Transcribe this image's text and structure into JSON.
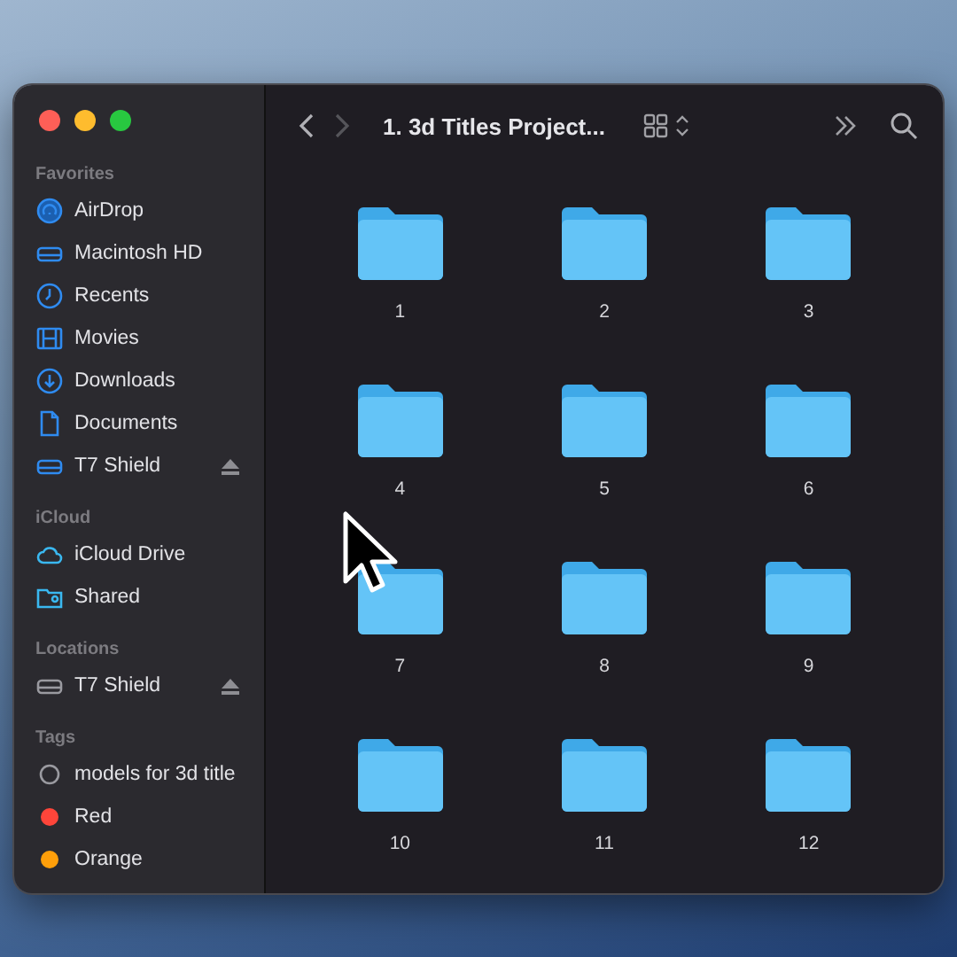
{
  "window": {
    "title": "1. 3d Titles Project..."
  },
  "toolbar": {
    "back_enabled": true,
    "forward_enabled": false
  },
  "sidebar": [
    {
      "heading": "Favorites",
      "items": [
        {
          "label": "AirDrop",
          "kind": "airdrop",
          "ejectable": false
        },
        {
          "label": "Macintosh HD",
          "kind": "drive",
          "ejectable": false
        },
        {
          "label": "Recents",
          "kind": "clock",
          "ejectable": false
        },
        {
          "label": "Movies",
          "kind": "film",
          "ejectable": false
        },
        {
          "label": "Downloads",
          "kind": "download",
          "ejectable": false
        },
        {
          "label": "Documents",
          "kind": "document",
          "ejectable": false
        },
        {
          "label": "T7 Shield",
          "kind": "drive",
          "ejectable": true
        }
      ]
    },
    {
      "heading": "iCloud",
      "items": [
        {
          "label": "iCloud Drive",
          "kind": "cloud",
          "ejectable": false
        },
        {
          "label": "Shared",
          "kind": "shared",
          "ejectable": false
        }
      ]
    },
    {
      "heading": "Locations",
      "items": [
        {
          "label": "T7 Shield",
          "kind": "drive-gray",
          "ejectable": true
        }
      ]
    },
    {
      "heading": "Tags",
      "items": [
        {
          "label": "models for 3d title",
          "kind": "tag",
          "ejectable": false
        },
        {
          "label": "Red",
          "kind": "tag",
          "color": "#ff453a",
          "ejectable": false
        },
        {
          "label": "Orange",
          "kind": "tag",
          "color": "#ff9f0a",
          "ejectable": false
        }
      ]
    }
  ],
  "folders": [
    "1",
    "2",
    "3",
    "4",
    "5",
    "6",
    "7",
    "8",
    "9",
    "10",
    "11",
    "12"
  ]
}
